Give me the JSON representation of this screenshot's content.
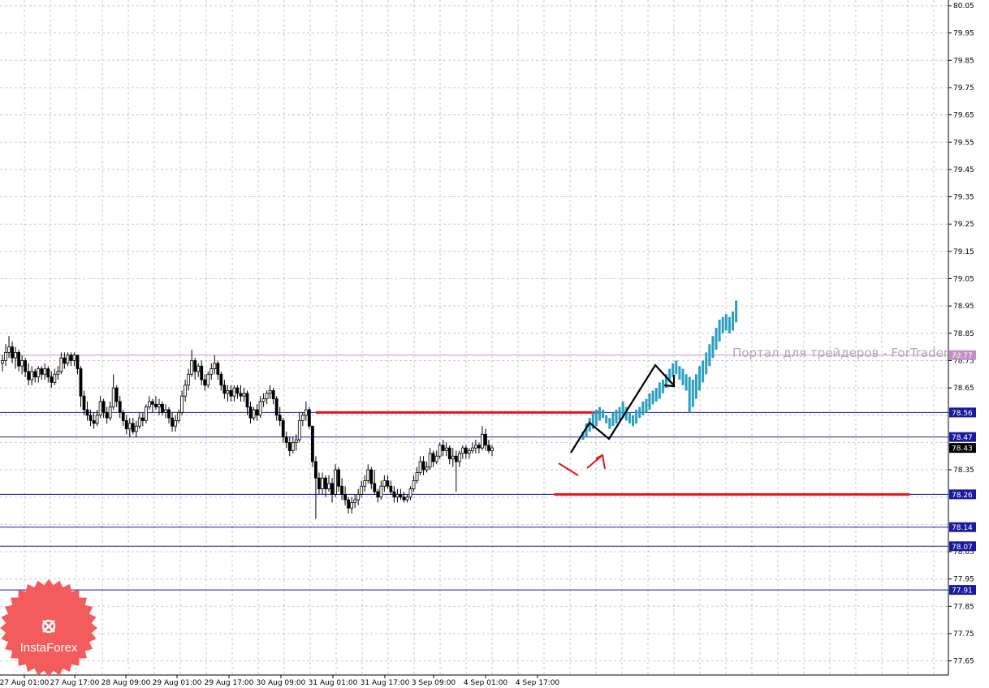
{
  "watermark": "Портал для трейдеров - ForTrader.ru",
  "logo": {
    "text": "InstaForex",
    "color": "#f25c5c"
  },
  "colors": {
    "bull_candle": "#000000",
    "bear_candle": "#000000",
    "projection_bars": "#2a9fbf",
    "support_resistance_red": "#e8111a",
    "blue_level": "#1a1aa0",
    "purple_level": "#c38fc6",
    "arrow_black": "#000000",
    "arrow_red": "#e8111a",
    "grid": "#c8c8c8"
  },
  "chart_data": {
    "type": "candlestick",
    "title": "",
    "xlabel": "",
    "ylabel": "",
    "ylim": [
      77.6,
      80.05
    ],
    "grid": true,
    "y_ticks": [
      "80.05",
      "79.95",
      "79.85",
      "79.75",
      "79.65",
      "79.55",
      "79.45",
      "79.35",
      "79.25",
      "79.15",
      "79.05",
      "78.95",
      "78.85",
      "78.75",
      "78.65",
      "78.35",
      "78.05",
      "77.95",
      "77.85",
      "77.75",
      "77.65"
    ],
    "x_ticks": [
      "27 Aug 01:00",
      "27 Aug 17:00",
      "28 Aug 09:00",
      "29 Aug 01:00",
      "29 Aug 17:00",
      "30 Aug 09:00",
      "31 Aug 01:00",
      "31 Aug 17:00",
      "3 Sep 09:00",
      "4 Sep 01:00",
      "4 Sep 17:00"
    ],
    "price_levels": [
      {
        "value": 78.77,
        "label": "78.77",
        "style": "purple"
      },
      {
        "value": 78.56,
        "label": "78.56",
        "style": "blue"
      },
      {
        "value": 78.47,
        "label": "78.47",
        "style": "blue"
      },
      {
        "value": 78.43,
        "label": "78.43",
        "style": "current"
      },
      {
        "value": 78.26,
        "label": "78.26",
        "style": "blue"
      },
      {
        "value": 78.14,
        "label": "78.14",
        "style": "blue"
      },
      {
        "value": 78.07,
        "label": "78.07",
        "style": "blue"
      },
      {
        "value": 77.91,
        "label": "77.91",
        "style": "blue"
      }
    ],
    "red_lines": [
      {
        "value": 78.56,
        "from_candle": 96,
        "to_candle": 183
      },
      {
        "value": 78.26,
        "from_candle": 169,
        "to_candle": 278
      }
    ],
    "candles": [
      [
        78.74,
        78.77,
        78.71,
        78.75
      ],
      [
        78.75,
        78.81,
        78.73,
        78.78
      ],
      [
        78.78,
        78.84,
        78.76,
        78.8
      ],
      [
        78.8,
        78.82,
        78.74,
        78.76
      ],
      [
        78.76,
        78.8,
        78.72,
        78.78
      ],
      [
        78.78,
        78.79,
        78.71,
        78.73
      ],
      [
        78.73,
        78.77,
        78.7,
        78.75
      ],
      [
        78.75,
        78.76,
        78.69,
        78.71
      ],
      [
        78.71,
        78.74,
        78.66,
        78.68
      ],
      [
        78.68,
        78.73,
        78.66,
        78.71
      ],
      [
        78.71,
        78.72,
        78.67,
        78.69
      ],
      [
        78.69,
        78.73,
        78.67,
        78.72
      ],
      [
        78.72,
        78.73,
        78.68,
        78.7
      ],
      [
        78.7,
        78.74,
        78.68,
        78.72
      ],
      [
        78.72,
        78.73,
        78.67,
        78.69
      ],
      [
        78.69,
        78.71,
        78.65,
        78.67
      ],
      [
        78.67,
        78.72,
        78.66,
        78.7
      ],
      [
        78.7,
        78.73,
        78.68,
        78.71
      ],
      [
        78.71,
        78.78,
        78.7,
        78.76
      ],
      [
        78.76,
        78.78,
        78.72,
        78.74
      ],
      [
        78.74,
        78.78,
        78.73,
        78.77
      ],
      [
        78.77,
        78.78,
        78.73,
        78.75
      ],
      [
        78.75,
        78.78,
        78.73,
        78.77
      ],
      [
        78.77,
        78.77,
        78.7,
        78.72
      ],
      [
        78.72,
        78.73,
        78.58,
        78.62
      ],
      [
        78.62,
        78.64,
        78.55,
        78.57
      ],
      [
        78.57,
        78.6,
        78.53,
        78.55
      ],
      [
        78.55,
        78.57,
        78.51,
        78.53
      ],
      [
        78.53,
        78.56,
        78.5,
        78.52
      ],
      [
        78.52,
        78.57,
        78.51,
        78.55
      ],
      [
        78.55,
        78.62,
        78.54,
        78.6
      ],
      [
        78.6,
        78.61,
        78.54,
        78.56
      ],
      [
        78.56,
        78.58,
        78.52,
        78.54
      ],
      [
        78.54,
        78.6,
        78.53,
        78.58
      ],
      [
        78.58,
        78.7,
        78.57,
        78.65
      ],
      [
        78.65,
        78.66,
        78.58,
        78.6
      ],
      [
        78.6,
        78.62,
        78.54,
        78.56
      ],
      [
        78.56,
        78.57,
        78.51,
        78.53
      ],
      [
        78.53,
        78.55,
        78.48,
        78.5
      ],
      [
        78.5,
        78.54,
        78.47,
        78.52
      ],
      [
        78.52,
        78.54,
        78.48,
        78.49
      ],
      [
        78.49,
        78.53,
        78.47,
        78.51
      ],
      [
        78.51,
        78.56,
        78.5,
        78.54
      ],
      [
        78.54,
        78.56,
        78.51,
        78.53
      ],
      [
        78.53,
        78.59,
        78.52,
        78.58
      ],
      [
        78.58,
        78.62,
        78.57,
        78.6
      ],
      [
        78.6,
        78.61,
        78.56,
        78.59
      ],
      [
        78.59,
        78.62,
        78.57,
        78.58
      ],
      [
        78.58,
        78.61,
        78.55,
        78.59
      ],
      [
        78.59,
        78.6,
        78.55,
        78.56
      ],
      [
        78.56,
        78.59,
        78.54,
        78.57
      ],
      [
        78.57,
        78.58,
        78.52,
        78.54
      ],
      [
        78.54,
        78.56,
        78.49,
        78.51
      ],
      [
        78.51,
        78.55,
        78.49,
        78.53
      ],
      [
        78.53,
        78.57,
        78.52,
        78.56
      ],
      [
        78.56,
        78.64,
        78.55,
        78.62
      ],
      [
        78.62,
        78.68,
        78.6,
        78.66
      ],
      [
        78.66,
        78.72,
        78.64,
        78.7
      ],
      [
        78.7,
        78.79,
        78.69,
        78.75
      ],
      [
        78.75,
        78.76,
        78.68,
        78.71
      ],
      [
        78.71,
        78.74,
        78.69,
        78.73
      ],
      [
        78.73,
        78.75,
        78.66,
        78.68
      ],
      [
        78.68,
        78.7,
        78.64,
        78.66
      ],
      [
        78.66,
        78.71,
        78.65,
        78.7
      ],
      [
        78.7,
        78.74,
        78.68,
        78.72
      ],
      [
        78.72,
        78.77,
        78.7,
        78.74
      ],
      [
        78.74,
        78.75,
        78.68,
        78.7
      ],
      [
        78.7,
        78.71,
        78.64,
        78.66
      ],
      [
        78.66,
        78.68,
        78.61,
        78.63
      ],
      [
        78.63,
        78.66,
        78.6,
        78.64
      ],
      [
        78.64,
        78.66,
        78.6,
        78.62
      ],
      [
        78.62,
        78.66,
        78.6,
        78.65
      ],
      [
        78.65,
        78.66,
        78.61,
        78.63
      ],
      [
        78.63,
        78.66,
        78.6,
        78.62
      ],
      [
        78.62,
        78.65,
        78.6,
        78.63
      ],
      [
        78.63,
        78.64,
        78.55,
        78.58
      ],
      [
        78.58,
        78.6,
        78.52,
        78.54
      ],
      [
        78.54,
        78.58,
        78.53,
        78.57
      ],
      [
        78.57,
        78.59,
        78.53,
        78.55
      ],
      [
        78.55,
        78.62,
        78.54,
        78.6
      ],
      [
        78.6,
        78.63,
        78.58,
        78.61
      ],
      [
        78.61,
        78.64,
        78.59,
        78.63
      ],
      [
        78.63,
        78.66,
        78.61,
        78.64
      ],
      [
        78.64,
        78.65,
        78.59,
        78.61
      ],
      [
        78.61,
        78.62,
        78.53,
        78.55
      ],
      [
        78.55,
        78.58,
        78.51,
        78.53
      ],
      [
        78.53,
        78.54,
        78.45,
        78.47
      ],
      [
        78.47,
        78.49,
        78.43,
        78.45
      ],
      [
        78.45,
        78.47,
        78.4,
        78.42
      ],
      [
        78.42,
        78.47,
        78.41,
        78.45
      ],
      [
        78.45,
        78.48,
        78.42,
        78.46
      ],
      [
        78.46,
        78.56,
        78.45,
        78.53
      ],
      [
        78.53,
        78.56,
        78.51,
        78.55
      ],
      [
        78.55,
        78.6,
        78.53,
        78.57
      ],
      [
        78.57,
        78.58,
        78.5,
        78.51
      ],
      [
        78.51,
        78.51,
        78.36,
        78.38
      ],
      [
        78.38,
        78.4,
        78.17,
        78.32
      ],
      [
        78.32,
        78.34,
        78.26,
        78.28
      ],
      [
        78.28,
        78.34,
        78.26,
        78.32
      ],
      [
        78.32,
        78.33,
        78.25,
        78.28
      ],
      [
        78.28,
        78.33,
        78.27,
        78.3
      ],
      [
        78.3,
        78.32,
        78.23,
        78.26
      ],
      [
        78.26,
        78.37,
        78.25,
        78.35
      ],
      [
        78.35,
        78.36,
        78.27,
        78.29
      ],
      [
        78.29,
        78.32,
        78.24,
        78.26
      ],
      [
        78.26,
        78.29,
        78.22,
        78.24
      ],
      [
        78.24,
        78.25,
        78.19,
        78.21
      ],
      [
        78.21,
        78.25,
        78.19,
        78.23
      ],
      [
        78.23,
        78.26,
        78.21,
        78.24
      ],
      [
        78.24,
        78.28,
        78.22,
        78.26
      ],
      [
        78.26,
        78.31,
        78.25,
        78.29
      ],
      [
        78.29,
        78.33,
        78.27,
        78.31
      ],
      [
        78.31,
        78.37,
        78.3,
        78.35
      ],
      [
        78.35,
        78.36,
        78.28,
        78.3
      ],
      [
        78.3,
        78.35,
        78.26,
        78.27
      ],
      [
        78.27,
        78.28,
        78.23,
        78.25
      ],
      [
        78.25,
        78.31,
        78.24,
        78.29
      ],
      [
        78.29,
        78.33,
        78.27,
        78.31
      ],
      [
        78.31,
        78.33,
        78.28,
        78.29
      ],
      [
        78.29,
        78.31,
        78.26,
        78.27
      ],
      [
        78.27,
        78.29,
        78.23,
        78.25
      ],
      [
        78.25,
        78.28,
        78.23,
        78.26
      ],
      [
        78.26,
        78.28,
        78.24,
        78.25
      ],
      [
        78.25,
        78.27,
        78.23,
        78.24
      ],
      [
        78.24,
        78.26,
        78.23,
        78.25
      ],
      [
        78.25,
        78.29,
        78.24,
        78.28
      ],
      [
        78.28,
        78.33,
        78.27,
        78.31
      ],
      [
        78.31,
        78.36,
        78.3,
        78.34
      ],
      [
        78.34,
        78.4,
        78.33,
        78.38
      ],
      [
        78.38,
        78.4,
        78.33,
        78.35
      ],
      [
        78.35,
        78.38,
        78.34,
        78.36
      ],
      [
        78.36,
        78.43,
        78.35,
        78.41
      ],
      [
        78.41,
        78.42,
        78.36,
        78.38
      ],
      [
        78.38,
        78.42,
        78.37,
        78.4
      ],
      [
        78.4,
        78.45,
        78.39,
        78.44
      ],
      [
        78.44,
        78.46,
        78.4,
        78.42
      ],
      [
        78.42,
        78.45,
        78.4,
        78.43
      ],
      [
        78.43,
        78.44,
        78.37,
        78.39
      ],
      [
        78.39,
        78.43,
        78.36,
        78.4
      ],
      [
        78.4,
        78.42,
        78.27,
        78.38
      ],
      [
        78.38,
        78.42,
        78.36,
        78.41
      ],
      [
        78.41,
        78.44,
        78.39,
        78.43
      ],
      [
        78.43,
        78.44,
        78.39,
        78.41
      ],
      [
        78.41,
        78.43,
        78.39,
        78.42
      ],
      [
        78.42,
        78.45,
        78.41,
        78.43
      ],
      [
        78.43,
        78.46,
        78.41,
        78.44
      ],
      [
        78.44,
        78.45,
        78.41,
        78.43
      ],
      [
        78.43,
        78.51,
        78.42,
        78.48
      ],
      [
        78.48,
        78.5,
        78.42,
        78.44
      ],
      [
        78.44,
        78.46,
        78.41,
        78.42
      ],
      [
        78.42,
        78.44,
        78.4,
        78.43
      ]
    ],
    "projection_bars": [
      [
        78.46,
        78.49
      ],
      [
        78.47,
        78.52
      ],
      [
        78.49,
        78.54
      ],
      [
        78.5,
        78.56
      ],
      [
        78.51,
        78.57
      ],
      [
        78.53,
        78.58
      ],
      [
        78.54,
        78.57
      ],
      [
        78.52,
        78.55
      ],
      [
        78.5,
        78.54
      ],
      [
        78.51,
        78.56
      ],
      [
        78.52,
        78.57
      ],
      [
        78.53,
        78.58
      ],
      [
        78.54,
        78.6
      ],
      [
        78.53,
        78.58
      ],
      [
        78.52,
        78.56
      ],
      [
        78.51,
        78.55
      ],
      [
        78.52,
        78.57
      ],
      [
        78.54,
        78.58
      ],
      [
        78.55,
        78.6
      ],
      [
        78.56,
        78.61
      ],
      [
        78.57,
        78.63
      ],
      [
        78.59,
        78.64
      ],
      [
        78.6,
        78.65
      ],
      [
        78.61,
        78.67
      ],
      [
        78.63,
        78.68
      ],
      [
        78.65,
        78.7
      ],
      [
        78.67,
        78.72
      ],
      [
        78.69,
        78.74
      ],
      [
        78.7,
        78.75
      ],
      [
        78.68,
        78.73
      ],
      [
        78.66,
        78.72
      ],
      [
        78.64,
        78.7
      ],
      [
        78.56,
        78.69
      ],
      [
        78.58,
        78.68
      ],
      [
        78.61,
        78.7
      ],
      [
        78.64,
        78.73
      ],
      [
        78.67,
        78.75
      ],
      [
        78.7,
        78.78
      ],
      [
        78.73,
        78.81
      ],
      [
        78.76,
        78.84
      ],
      [
        78.79,
        78.87
      ],
      [
        78.82,
        78.9
      ],
      [
        78.85,
        78.91
      ],
      [
        78.86,
        78.92
      ],
      [
        78.85,
        78.91
      ],
      [
        78.86,
        78.93
      ],
      [
        78.89,
        78.97
      ]
    ]
  }
}
